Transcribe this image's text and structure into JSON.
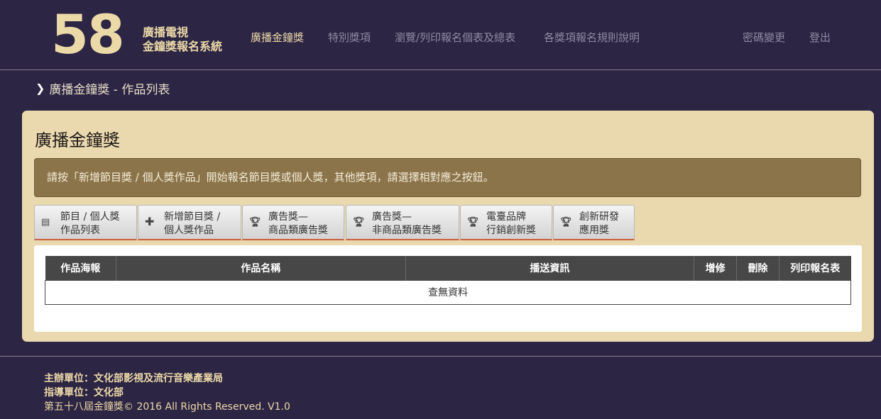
{
  "header": {
    "logo_number": "58",
    "logo_line1": "廣播電視",
    "logo_line2": "金鐘獎報名系統",
    "nav": [
      {
        "label": "廣播金鐘獎",
        "active": true
      },
      {
        "label": "特別獎項"
      },
      {
        "label": "瀏覽/列印報名個表及總表"
      },
      {
        "label": "各獎項報名規則說明"
      },
      {
        "label": "密碼變更"
      },
      {
        "label": "登出"
      }
    ]
  },
  "breadcrumb": {
    "icon": "chevron-right-icon",
    "text": "廣播金鐘獎 - 作品列表"
  },
  "panel": {
    "title": "廣播金鐘獎",
    "notice": "請按「新增節目獎 / 個人獎作品」開始報名節目獎或個人獎，其他獎項，請選擇相對應之按鈕。",
    "tabs": [
      {
        "icon": "list-icon",
        "line1": "節目 / 個人獎",
        "line2": "作品列表"
      },
      {
        "icon": "plus-icon",
        "line1": "新增節目獎 /",
        "line2": "個人獎作品"
      },
      {
        "icon": "trophy-icon",
        "line1": "廣告獎—",
        "line2": "商品類廣告獎"
      },
      {
        "icon": "trophy-icon",
        "line1": "廣告獎—",
        "line2": "非商品類廣告獎"
      },
      {
        "icon": "trophy-icon",
        "line1": "電臺品牌",
        "line2": "行銷創新獎"
      },
      {
        "icon": "trophy-icon",
        "line1": "創新研發",
        "line2": "應用獎"
      }
    ],
    "table": {
      "columns": [
        "作品海報",
        "作品名稱",
        "播送資訊",
        "增修",
        "刪除",
        "列印報名表"
      ],
      "empty_text": "查無資料"
    }
  },
  "footer": {
    "organizer": "主辦單位：文化部影視及流行音樂產業局",
    "advisor": "指導單位：文化部",
    "copyright": "第五十八屆金鐘獎© 2016 All Rights Reserved. V1.0"
  }
}
